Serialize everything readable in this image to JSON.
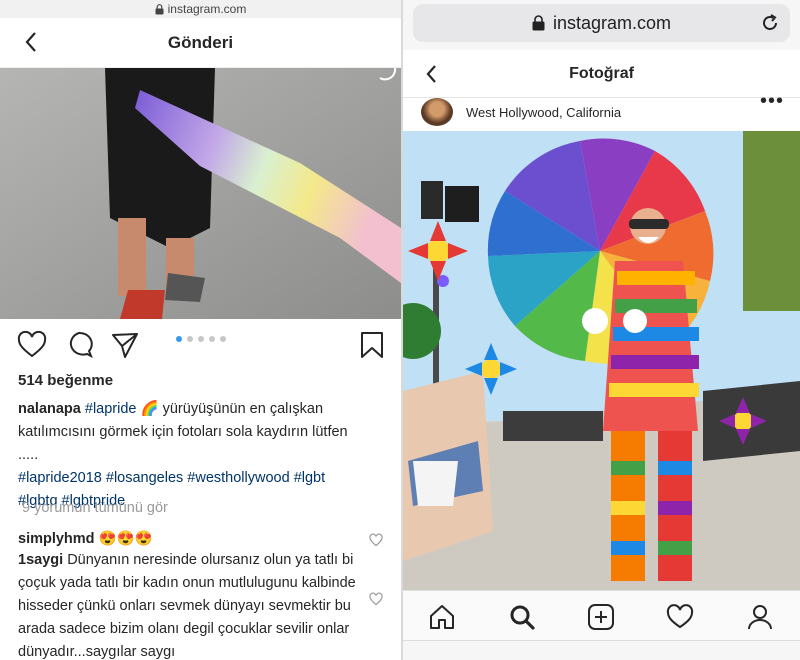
{
  "left": {
    "url": "instagram.com",
    "title": "Gönderi",
    "likes": "514 beğenme",
    "caption": {
      "username": "nalanapa",
      "line1_tag": "#lapride",
      "line1_emoji": "🌈",
      "line1_rest": " yürüyüşünün en çalışkan",
      "line2": "katılımcısını görmek için fotoları sola kaydırın lütfen",
      "line3": ".....",
      "hashtags_line1": "#lapride2018 #losangeles #westhollywood #lgbt",
      "hashtags_line2": "#lgbtq #lgbtpride"
    },
    "view_all": "9 yorumun tümünü gör",
    "comments": [
      {
        "username": "simplyhmd",
        "text": "😍😍😍"
      },
      {
        "username": "1saygi",
        "text": "Dünyanın neresinde olursanız olun ya tatlı bi çoçuk yada tatlı bir kadın onun mutlulugunu kalbinde hisseder çünkü onları sevmek dünyayı sevmektir bu arada sadece bizim olanı degil çocuklar sevilir onlar dünyadır...saygılar saygı"
      }
    ],
    "carousel": {
      "count": 5,
      "active": 0
    },
    "icons": [
      "back-icon",
      "lock-icon",
      "heart-icon",
      "comment-icon",
      "share-icon",
      "bookmark-icon"
    ]
  },
  "right": {
    "url": "instagram.com",
    "title": "Fotoğraf",
    "location": "West Hollywood, California",
    "more": "•••",
    "icons": [
      "back-icon",
      "lock-icon",
      "reload-icon",
      "home-icon",
      "search-icon",
      "add-icon",
      "heart-icon",
      "profile-icon"
    ],
    "colors": {
      "active_dot": "#3897f0",
      "hashtag": "#003569",
      "muted": "#999999"
    }
  }
}
